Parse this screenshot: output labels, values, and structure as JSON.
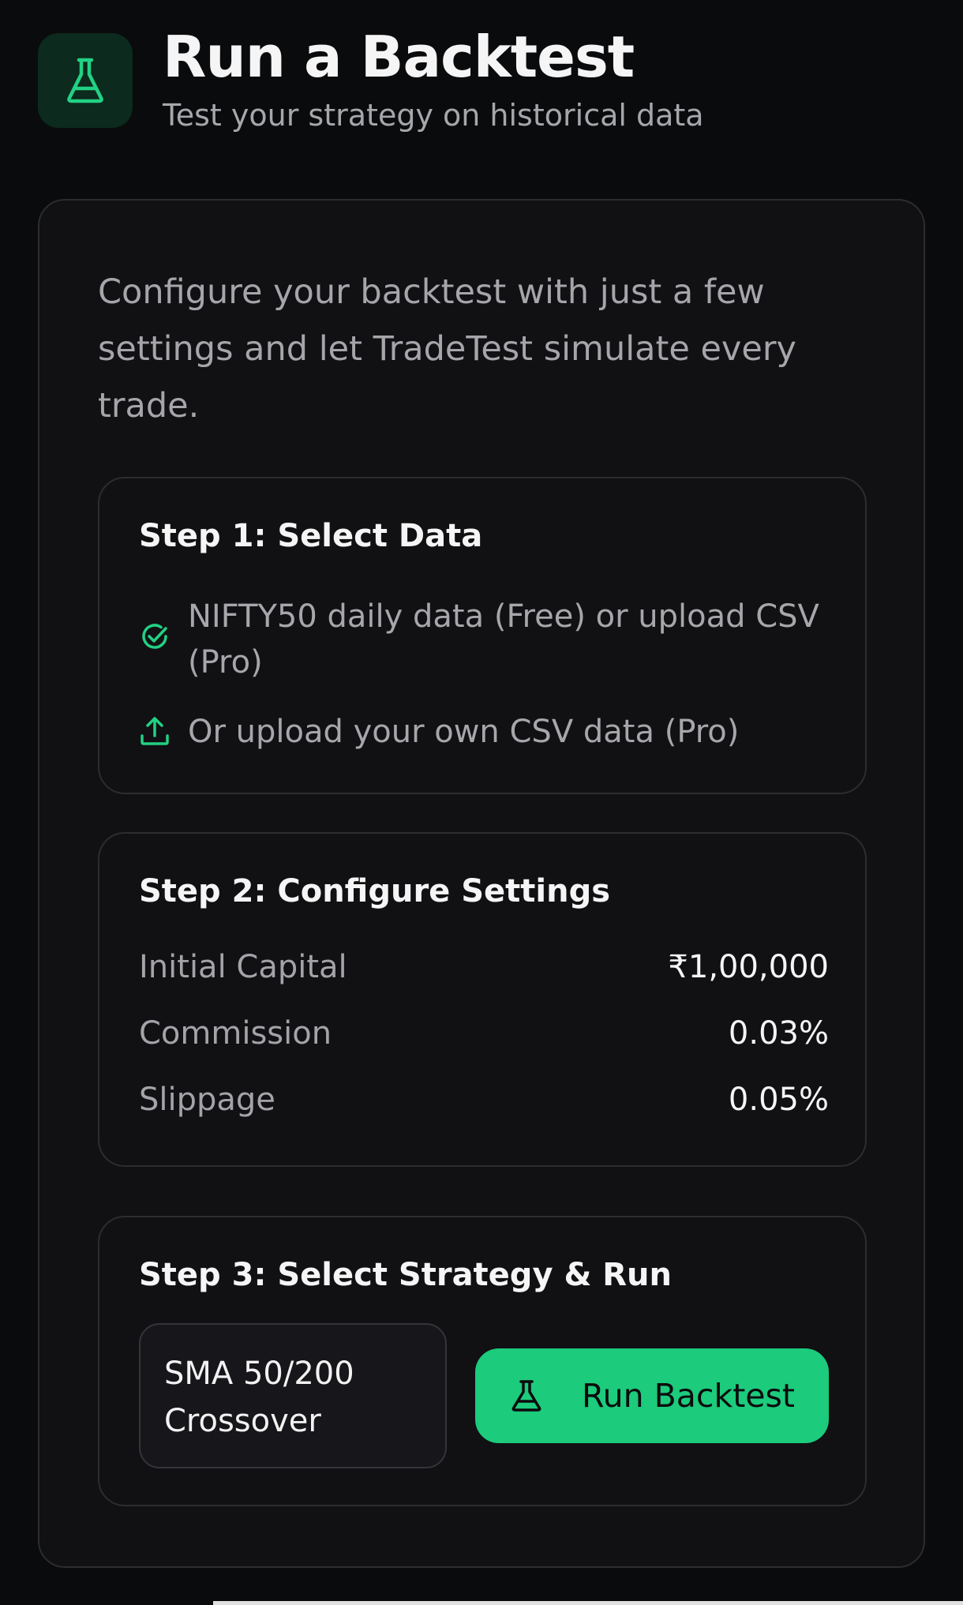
{
  "header": {
    "title": "Run a Backtest",
    "subtitle": "Test your strategy on historical data",
    "icon": "flask-icon"
  },
  "intro": "Configure your backtest with just a few settings and let TradeTest simulate every trade.",
  "step1": {
    "title": "Step 1: Select Data",
    "items": [
      {
        "icon": "check-circle-icon",
        "text": "NIFTY50 daily data (Free) or upload CSV (Pro)"
      },
      {
        "icon": "upload-icon",
        "text": "Or upload your own CSV data (Pro)"
      }
    ]
  },
  "step2": {
    "title": "Step 2: Configure Settings",
    "settings": [
      {
        "label": "Initial Capital",
        "value": "₹1,00,000"
      },
      {
        "label": "Commission",
        "value": "0.03%"
      },
      {
        "label": "Slippage",
        "value": "0.05%"
      }
    ]
  },
  "step3": {
    "title": "Step 3: Select Strategy & Run",
    "strategy": "SMA 50/200 Crossover",
    "run_label": "Run Backtest"
  },
  "colors": {
    "accent": "#1ccb7c",
    "background": "#0a0b0d",
    "card": "#111114",
    "border": "#2c2c31"
  }
}
